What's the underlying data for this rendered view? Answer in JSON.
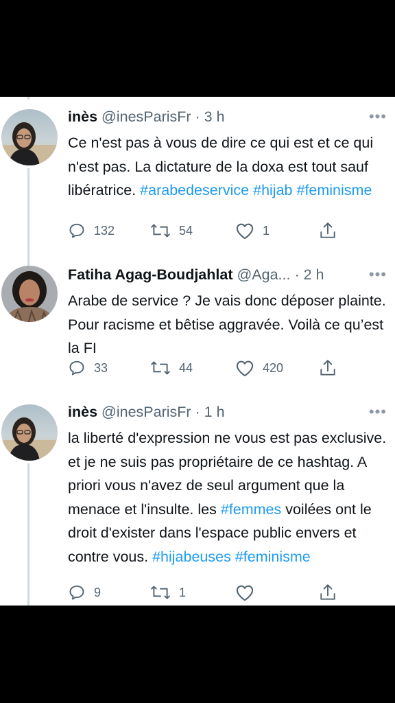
{
  "tweets": [
    {
      "display_name": "inès",
      "handle": "@inesParisFr",
      "time": "· 3 h",
      "more": "•••",
      "body": [
        {
          "text": "Ce n'est pas à vous de dire ce qui est et ce qui n'est pas. La dictature de la doxa est tout sauf libératrice. "
        },
        {
          "text": "#arabedeservice",
          "tag": true
        },
        {
          "text": " "
        },
        {
          "text": "#hijab",
          "tag": true
        },
        {
          "text": " "
        },
        {
          "text": "#feminisme",
          "tag": true
        }
      ],
      "replies": "132",
      "retweets": "54",
      "likes": "1",
      "avatar_icon": "woman-glasses-avatar"
    },
    {
      "display_name": "Fatiha Agag-Boudjahlat",
      "handle": "@Aga...",
      "time": "· 2 h",
      "more": "•••",
      "body": [
        {
          "text": "Arabe de service ? Je vais donc déposer plainte. Pour racisme et bêtise aggravée. Voilà ce qu’est la FI"
        }
      ],
      "replies": "33",
      "retweets": "44",
      "likes": "420",
      "avatar_icon": "woman-dark-hair-avatar"
    },
    {
      "display_name": "inès",
      "handle": "@inesParisFr",
      "time": "· 1 h",
      "more": "•••",
      "body": [
        {
          "text": "la liberté d'expression ne vous est pas exclusive. et je ne suis pas propriétaire de ce hashtag. A priori vous n'avez de seul argument que la menace et l'insulte. les "
        },
        {
          "text": "#femmes",
          "tag": true
        },
        {
          "text": "  voilées ont le droit d'exister dans l'espace public envers et contre vous. "
        },
        {
          "text": "#hijabeuses",
          "tag": true
        },
        {
          "text": " "
        },
        {
          "text": "#feminisme",
          "tag": true
        }
      ],
      "replies": "9",
      "retweets": "1",
      "likes": "",
      "avatar_icon": "woman-glasses-avatar"
    }
  ]
}
